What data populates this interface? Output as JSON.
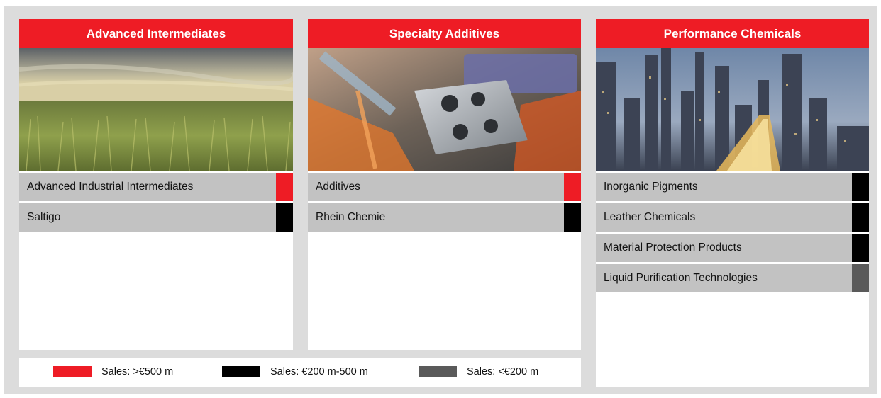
{
  "colors": {
    "over_500": "#ee1c25",
    "between_200_500": "#000000",
    "under_200": "#5a5a5a",
    "frame": "#dcdcdc",
    "row": "#c2c2c2"
  },
  "segments": [
    {
      "title": "Advanced Intermediates",
      "image": "wheat-field-photo",
      "units": [
        {
          "label": "Advanced Industrial Intermediates",
          "sales_class": "over_500"
        },
        {
          "label": "Saltigo",
          "sales_class": "between_200_500"
        }
      ]
    },
    {
      "title": "Specialty Additives",
      "image": "machining-workpiece-photo",
      "units": [
        {
          "label": "Additives",
          "sales_class": "over_500"
        },
        {
          "label": "Rhein Chemie",
          "sales_class": "between_200_500"
        }
      ]
    },
    {
      "title": "Performance Chemicals",
      "image": "city-skyline-photo",
      "units": [
        {
          "label": "Inorganic Pigments",
          "sales_class": "between_200_500"
        },
        {
          "label": "Leather Chemicals",
          "sales_class": "between_200_500"
        },
        {
          "label": "Material Protection Products",
          "sales_class": "between_200_500"
        },
        {
          "label": "Liquid Purification Technologies",
          "sales_class": "under_200"
        }
      ]
    }
  ],
  "legend": [
    {
      "label": "Sales: >€500 m",
      "sales_class": "over_500"
    },
    {
      "label": "Sales: €200 m-500 m",
      "sales_class": "between_200_500"
    },
    {
      "label": "Sales: <€200 m",
      "sales_class": "under_200"
    }
  ]
}
